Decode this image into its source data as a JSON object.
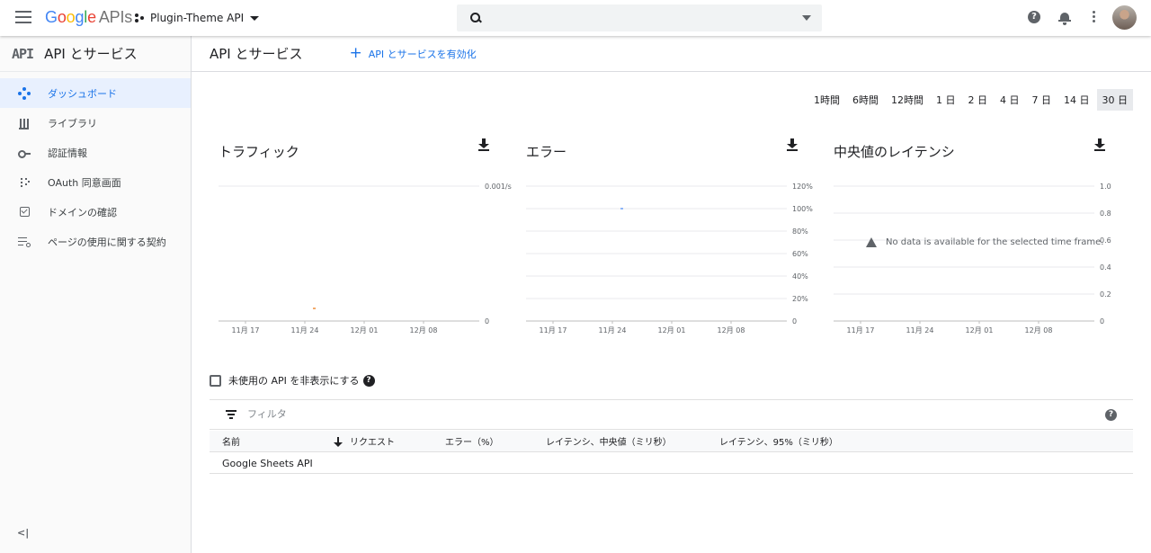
{
  "topbar": {
    "logo_google": "Google",
    "logo_apis": "APIs",
    "project_name": "Plugin-Theme API",
    "search_placeholder": "",
    "help_glyph": "?",
    "icons": [
      "menu-icon",
      "project-icon",
      "search-icon",
      "help-icon",
      "notifications-icon",
      "more-vert-icon",
      "avatar"
    ]
  },
  "sidebar": {
    "logo": "API",
    "title": "API とサービス",
    "items": [
      {
        "label": "ダッシュボード",
        "icon": "dashboard-icon",
        "active": true
      },
      {
        "label": "ライブラリ",
        "icon": "library-icon",
        "active": false
      },
      {
        "label": "認証情報",
        "icon": "key-icon",
        "active": false
      },
      {
        "label": "OAuth 同意画面",
        "icon": "oauth-icon",
        "active": false
      },
      {
        "label": "ドメインの確認",
        "icon": "checkbox-icon",
        "active": false
      },
      {
        "label": "ページの使用に関する契約",
        "icon": "settings-list-icon",
        "active": false
      }
    ],
    "collapse_label": "<|"
  },
  "main": {
    "title": "API とサービス",
    "enable_button": "API とサービスを有効化",
    "time_ranges": [
      "1時間",
      "6時間",
      "12時間",
      "1 日",
      "2 日",
      "4 日",
      "7 日",
      "14 日",
      "30 日"
    ],
    "selected_range": "30 日",
    "hide_unused_label": "未使用の API を非表示にする",
    "filter_placeholder": "フィルタ",
    "table": {
      "columns": [
        "名前",
        "リクエスト",
        "エラー（%）",
        "レイテンシ、中央値（ミリ秒）",
        "レイテンシ、95%（ミリ秒）"
      ],
      "sorted_column": "リクエスト",
      "rows": [
        [
          "Google Sheets API",
          "",
          "",
          "",
          ""
        ]
      ]
    }
  },
  "colors": {
    "accent": "#1a73e8",
    "traffic_mark": "#e8710a",
    "error_mark": "#4285f4",
    "grid": "#e0e0e0"
  },
  "chart_data": [
    {
      "type": "line",
      "title": "トラフィック",
      "categories": [
        "11月 17",
        "11月 24",
        "12月 01",
        "12月 08"
      ],
      "y_ticks": [
        "0.001/s",
        "0"
      ],
      "ylim": [
        0,
        0.001
      ],
      "series": [
        {
          "values": [
            0,
            0.0001,
            0,
            0
          ]
        }
      ]
    },
    {
      "type": "line",
      "title": "エラー",
      "categories": [
        "11月 17",
        "11月 24",
        "12月 01",
        "12月 08"
      ],
      "y_ticks": [
        "120%",
        "100%",
        "80%",
        "60%",
        "40%",
        "20%",
        "0"
      ],
      "ylim": [
        0,
        120
      ],
      "series": [
        {
          "values": [
            0,
            100,
            0,
            0
          ]
        }
      ]
    },
    {
      "type": "line",
      "title": "中央値のレイテンシ",
      "categories": [
        "11月 17",
        "11月 24",
        "12月 01",
        "12月 08"
      ],
      "y_ticks": [
        "1.0",
        "0.8",
        "0.6",
        "0.4",
        "0.2",
        "0"
      ],
      "ylim": [
        0,
        1
      ],
      "message": "No data is available for the selected time frame.",
      "series": []
    }
  ]
}
